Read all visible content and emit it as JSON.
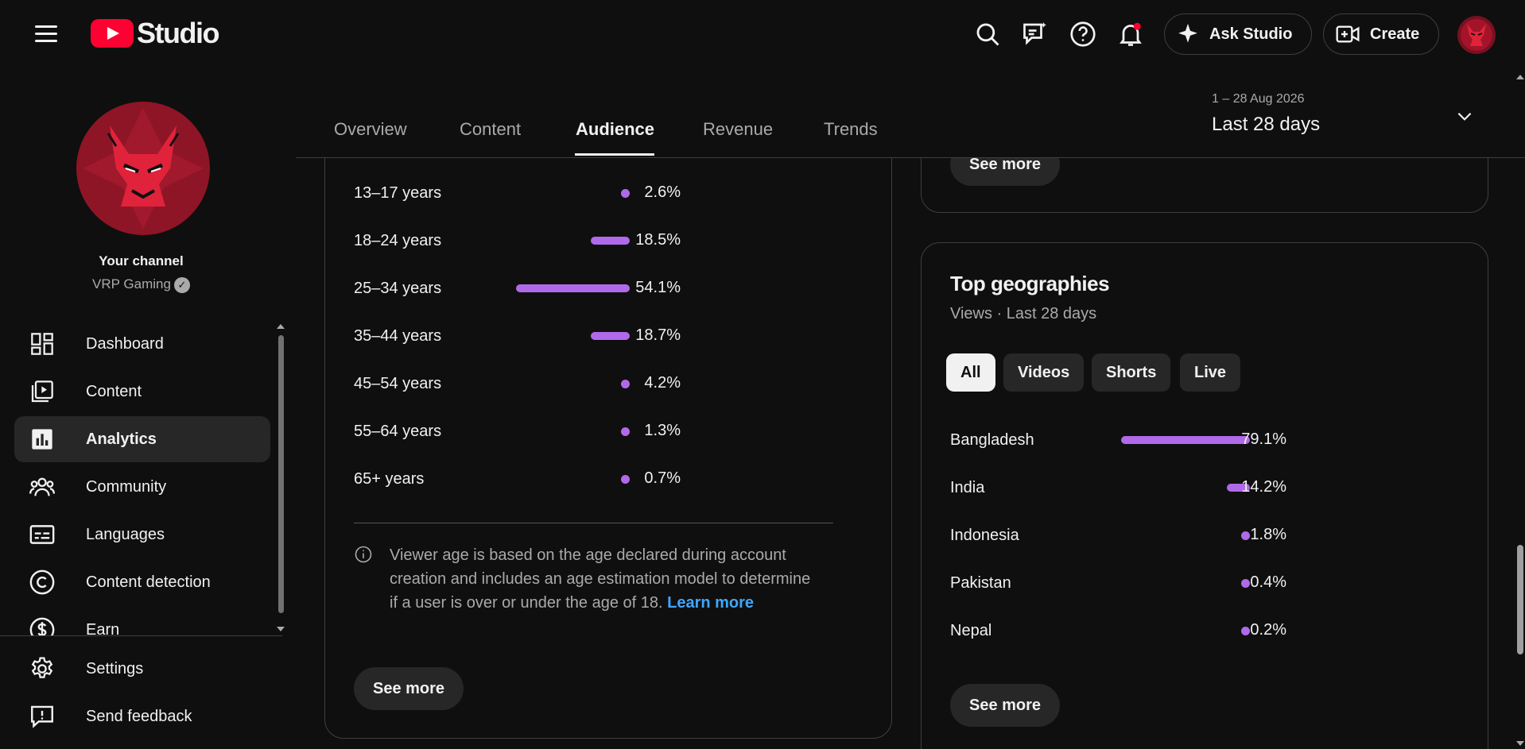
{
  "header": {
    "logo_text": "Studio",
    "ask_studio_label": "Ask Studio",
    "create_label": "Create",
    "icons": [
      "menu-icon",
      "search-icon",
      "feedback-chat-icon",
      "help-icon",
      "notifications-bell-icon"
    ]
  },
  "sidebar": {
    "channel_title": "Your channel",
    "channel_name": "VRP Gaming",
    "items": [
      {
        "label": "Dashboard",
        "icon": "dashboard-icon"
      },
      {
        "label": "Content",
        "icon": "content-icon"
      },
      {
        "label": "Analytics",
        "icon": "analytics-icon",
        "active": true
      },
      {
        "label": "Community",
        "icon": "community-icon"
      },
      {
        "label": "Languages",
        "icon": "subtitles-icon"
      },
      {
        "label": "Content detection",
        "icon": "copyright-icon"
      },
      {
        "label": "Earn",
        "icon": "dollar-icon"
      }
    ],
    "bottom_items": [
      {
        "label": "Settings",
        "icon": "gear-icon"
      },
      {
        "label": "Send feedback",
        "icon": "feedback-icon"
      }
    ]
  },
  "tabs": {
    "items": [
      "Overview",
      "Content",
      "Audience",
      "Revenue",
      "Trends"
    ],
    "active": "Audience"
  },
  "date_picker": {
    "range": "1 – 28 Aug 2026",
    "label": "Last 28 days"
  },
  "age_card": {
    "rows": [
      {
        "label": "13–17 years",
        "value": 2.6,
        "display": "2.6%"
      },
      {
        "label": "18–24 years",
        "value": 18.5,
        "display": "18.5%"
      },
      {
        "label": "25–34 years",
        "value": 54.1,
        "display": "54.1%"
      },
      {
        "label": "35–44 years",
        "value": 18.7,
        "display": "18.7%"
      },
      {
        "label": "45–54 years",
        "value": 4.2,
        "display": "4.2%"
      },
      {
        "label": "55–64 years",
        "value": 1.3,
        "display": "1.3%"
      },
      {
        "label": "65+ years",
        "value": 0.7,
        "display": "0.7%"
      }
    ],
    "note_text": "Viewer age is based on the age declared during account creation and includes an age estimation model to determine if a user is over or under the age of 18.",
    "note_link": "Learn more",
    "see_more_label": "See more"
  },
  "prev_card": {
    "see_more_label": "See more"
  },
  "geo_card": {
    "title": "Top geographies",
    "subtitle": "Views · Last 28 days",
    "chips": [
      "All",
      "Videos",
      "Shorts",
      "Live"
    ],
    "active_chip": "All",
    "rows": [
      {
        "label": "Bangladesh",
        "value": 79.1,
        "display": "79.1%"
      },
      {
        "label": "India",
        "value": 14.2,
        "display": "14.2%"
      },
      {
        "label": "Indonesia",
        "value": 1.8,
        "display": "1.8%"
      },
      {
        "label": "Pakistan",
        "value": 0.4,
        "display": "0.4%"
      },
      {
        "label": "Nepal",
        "value": 0.2,
        "display": "0.2%"
      }
    ],
    "see_more_label": "See more"
  },
  "colors": {
    "background": "#0f0f0f",
    "bar": "#b06ae9",
    "link": "#3ea6ff",
    "brand_red": "#ff0033"
  }
}
